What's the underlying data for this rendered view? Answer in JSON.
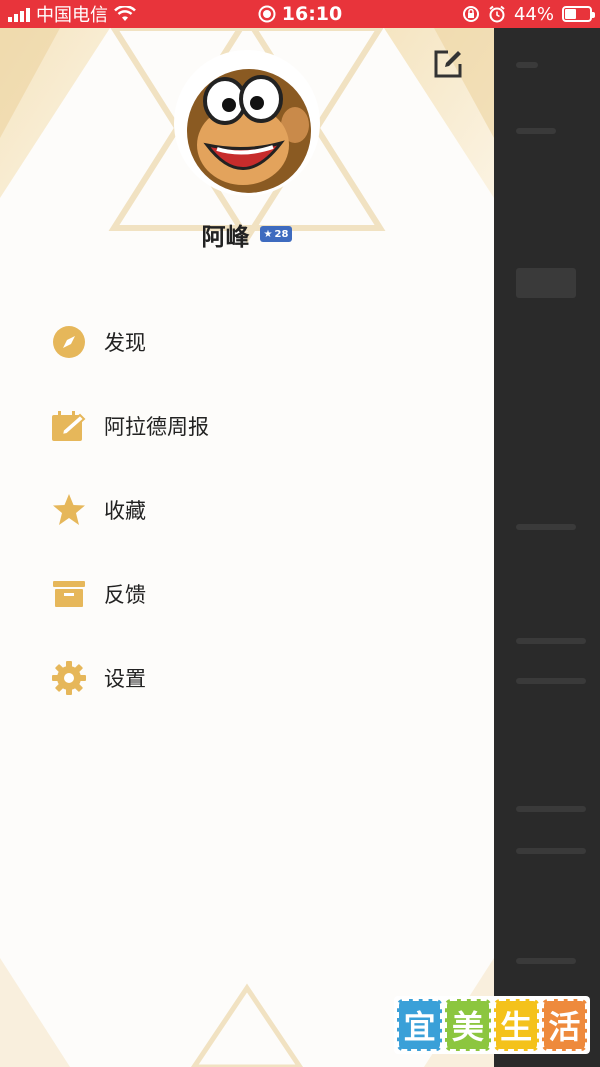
{
  "status_bar": {
    "carrier": "中国电信",
    "time": "16:10",
    "battery": "44%"
  },
  "profile": {
    "name": "阿峰",
    "level": "28"
  },
  "menu": [
    {
      "label": "发现",
      "icon": "compass-icon"
    },
    {
      "label": "阿拉德周报",
      "icon": "calendar-pencil-icon"
    },
    {
      "label": "收藏",
      "icon": "star-icon"
    },
    {
      "label": "反馈",
      "icon": "inbox-icon"
    },
    {
      "label": "设置",
      "icon": "gear-icon"
    }
  ],
  "watermark": {
    "chars": [
      "宜",
      "美",
      "生",
      "活"
    ]
  },
  "colors": {
    "status_bar": "#e8343b",
    "accent_gold": "#e6b75a",
    "drawer_bg": "#fdfcfa"
  }
}
